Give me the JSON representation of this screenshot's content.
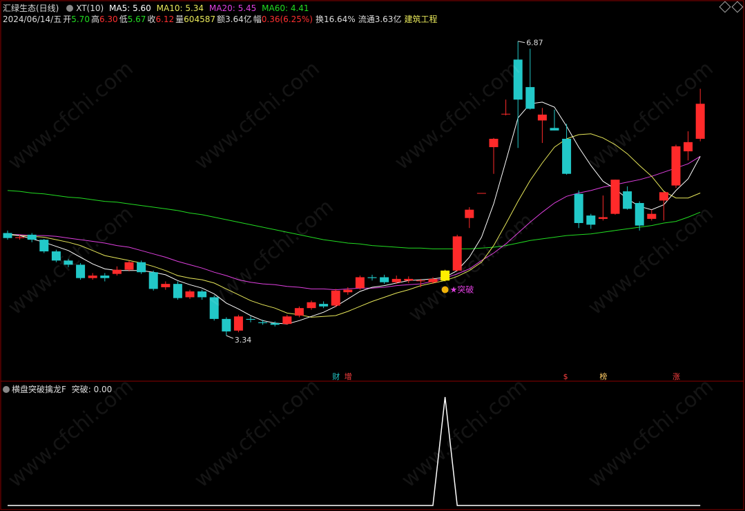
{
  "header": {
    "stock_name": "汇绿生态(日线)",
    "indicator": "XT(10)",
    "ma5": "MA5: 5.60",
    "ma10": "MA10: 5.34",
    "ma20": "MA20: 5.45",
    "ma60": "MA60: 4.41",
    "date": "2024/06/14/五",
    "open_label": "开",
    "open_value": "5.70",
    "high_label": "高",
    "high_value": "6.30",
    "low_label": "低",
    "low_value": "5.67",
    "close_label": "收",
    "close_value": "6.12",
    "volume_label": "量",
    "volume_value": "604587",
    "amount_label": "额",
    "amount_value": "3.64亿",
    "change_label": "幅",
    "change_value": "0.36(6.25%)",
    "turnover": "换16.64%",
    "float": "流通3.63亿",
    "sector": "建筑工程"
  },
  "sub_header": {
    "name": "横盘突破擒龙F",
    "value_label": "突破: 0.00"
  },
  "annotations": {
    "high_label": "6.87",
    "low_label": "3.34",
    "breakout_label": "突破"
  },
  "bottom_markers": [
    "财",
    "增",
    "$",
    "榜",
    "涨"
  ],
  "watermark_text": "www.cfchi.com",
  "colors": {
    "up": "#ff2a2a",
    "down": "#22c8c8",
    "ma5": "#ffffff",
    "ma10": "#e8e85a",
    "ma20": "#e040e0",
    "ma60": "#22dd22"
  },
  "chart_data": {
    "type": "candlestick",
    "y_range": [
      3.1,
      7.0
    ],
    "candles": [
      {
        "o": 4.57,
        "c": 4.51,
        "h": 4.6,
        "l": 4.49
      },
      {
        "o": 4.51,
        "c": 4.52,
        "h": 4.55,
        "l": 4.49
      },
      {
        "o": 4.55,
        "c": 4.49,
        "h": 4.57,
        "l": 4.46
      },
      {
        "o": 4.49,
        "c": 4.35,
        "h": 4.5,
        "l": 4.33
      },
      {
        "o": 4.35,
        "c": 4.24,
        "h": 4.37,
        "l": 4.22
      },
      {
        "o": 4.24,
        "c": 4.19,
        "h": 4.26,
        "l": 4.16
      },
      {
        "o": 4.19,
        "c": 4.03,
        "h": 4.21,
        "l": 4.01
      },
      {
        "o": 4.03,
        "c": 4.06,
        "h": 4.09,
        "l": 4.01
      },
      {
        "o": 4.06,
        "c": 4.03,
        "h": 4.09,
        "l": 3.99
      },
      {
        "o": 4.08,
        "c": 4.13,
        "h": 4.17,
        "l": 4.06
      },
      {
        "o": 4.13,
        "c": 4.22,
        "h": 4.24,
        "l": 4.11
      },
      {
        "o": 4.22,
        "c": 4.1,
        "h": 4.24,
        "l": 4.08
      },
      {
        "o": 4.1,
        "c": 3.9,
        "h": 4.12,
        "l": 3.88
      },
      {
        "o": 3.92,
        "c": 3.96,
        "h": 3.99,
        "l": 3.89
      },
      {
        "o": 3.96,
        "c": 3.79,
        "h": 3.99,
        "l": 3.77
      },
      {
        "o": 3.8,
        "c": 3.87,
        "h": 3.89,
        "l": 3.78
      },
      {
        "o": 3.87,
        "c": 3.8,
        "h": 3.89,
        "l": 3.77
      },
      {
        "o": 3.8,
        "c": 3.54,
        "h": 3.82,
        "l": 3.52
      },
      {
        "o": 3.54,
        "c": 3.39,
        "h": 3.56,
        "l": 3.34
      },
      {
        "o": 3.4,
        "c": 3.57,
        "h": 3.59,
        "l": 3.38
      },
      {
        "o": 3.54,
        "c": 3.53,
        "h": 3.57,
        "l": 3.5
      },
      {
        "o": 3.5,
        "c": 3.49,
        "h": 3.53,
        "l": 3.47
      },
      {
        "o": 3.49,
        "c": 3.47,
        "h": 3.51,
        "l": 3.45
      },
      {
        "o": 3.48,
        "c": 3.57,
        "h": 3.59,
        "l": 3.47
      },
      {
        "o": 3.58,
        "c": 3.67,
        "h": 3.69,
        "l": 3.56
      },
      {
        "o": 3.67,
        "c": 3.74,
        "h": 3.76,
        "l": 3.65
      },
      {
        "o": 3.72,
        "c": 3.69,
        "h": 3.75,
        "l": 3.67
      },
      {
        "o": 3.7,
        "c": 3.88,
        "h": 3.9,
        "l": 3.68
      },
      {
        "o": 3.86,
        "c": 3.89,
        "h": 3.92,
        "l": 3.83
      },
      {
        "o": 3.91,
        "c": 4.04,
        "h": 4.06,
        "l": 3.89
      },
      {
        "o": 4.04,
        "c": 4.03,
        "h": 4.07,
        "l": 4.0
      },
      {
        "o": 4.04,
        "c": 3.98,
        "h": 4.07,
        "l": 3.96
      },
      {
        "o": 3.98,
        "c": 4.02,
        "h": 4.06,
        "l": 3.96
      },
      {
        "o": 4.0,
        "c": 4.02,
        "h": 4.05,
        "l": 3.97
      },
      {
        "o": 4.0,
        "c": 4.0,
        "h": 4.02,
        "l": 3.92
      },
      {
        "o": 3.98,
        "c": 4.02,
        "h": 4.04,
        "l": 3.96
      },
      {
        "o": 4.0,
        "c": 4.12,
        "h": 4.13,
        "l": 3.99
      },
      {
        "o": 4.12,
        "c": 4.53,
        "h": 4.55,
        "l": 4.11
      },
      {
        "o": 4.75,
        "c": 4.85,
        "h": 4.88,
        "l": 4.63
      },
      {
        "o": 5.05,
        "c": 5.05,
        "h": 5.05,
        "l": 5.05
      },
      {
        "o": 5.6,
        "c": 5.7,
        "h": 5.71,
        "l": 5.28
      },
      {
        "o": 6.0,
        "c": 6.0,
        "h": 6.17,
        "l": 5.98
      },
      {
        "o": 6.65,
        "c": 6.17,
        "h": 6.87,
        "l": 5.59
      },
      {
        "o": 6.32,
        "c": 6.06,
        "h": 6.78,
        "l": 6.05
      },
      {
        "o": 5.92,
        "c": 5.99,
        "h": 6.07,
        "l": 5.65
      },
      {
        "o": 5.83,
        "c": 5.8,
        "h": 6.05,
        "l": 5.8
      },
      {
        "o": 5.7,
        "c": 5.28,
        "h": 5.88,
        "l": 5.27
      },
      {
        "o": 5.04,
        "c": 4.69,
        "h": 5.08,
        "l": 4.63
      },
      {
        "o": 4.78,
        "c": 4.67,
        "h": 4.8,
        "l": 4.62
      },
      {
        "o": 4.74,
        "c": 4.76,
        "h": 5.02,
        "l": 4.72
      },
      {
        "o": 4.8,
        "c": 5.21,
        "h": 5.21,
        "l": 4.79
      },
      {
        "o": 5.07,
        "c": 4.86,
        "h": 5.13,
        "l": 4.85
      },
      {
        "o": 4.93,
        "c": 4.66,
        "h": 4.95,
        "l": 4.6
      },
      {
        "o": 4.74,
        "c": 4.8,
        "h": 4.85,
        "l": 4.72
      },
      {
        "o": 4.96,
        "c": 5.06,
        "h": 5.06,
        "l": 4.72
      },
      {
        "o": 5.14,
        "c": 5.61,
        "h": 5.63,
        "l": 5.11
      },
      {
        "o": 5.55,
        "c": 5.66,
        "h": 5.79,
        "l": 5.44
      },
      {
        "o": 5.7,
        "c": 6.12,
        "h": 6.3,
        "l": 5.67
      }
    ],
    "ma5": [
      4.56,
      4.54,
      4.5,
      4.46,
      4.41,
      4.36,
      4.28,
      4.2,
      4.14,
      4.12,
      4.12,
      4.12,
      4.1,
      4.07,
      4.0,
      3.95,
      3.91,
      3.84,
      3.73,
      3.66,
      3.58,
      3.52,
      3.49,
      3.48,
      3.52,
      3.57,
      3.62,
      3.69,
      3.78,
      3.87,
      3.92,
      3.94,
      3.97,
      4.0,
      4.01,
      4.02,
      4.04,
      4.12,
      4.28,
      4.52,
      4.92,
      5.43,
      5.95,
      6.12,
      6.14,
      6.08,
      5.85,
      5.6,
      5.38,
      5.19,
      5.1,
      4.98,
      4.89,
      4.85,
      4.91,
      5.08,
      5.22,
      5.49
    ],
    "ma10": [
      4.55,
      4.54,
      4.53,
      4.52,
      4.49,
      4.46,
      4.42,
      4.36,
      4.3,
      4.27,
      4.24,
      4.21,
      4.17,
      4.12,
      4.06,
      4.03,
      4.01,
      3.97,
      3.9,
      3.83,
      3.76,
      3.71,
      3.67,
      3.61,
      3.59,
      3.56,
      3.57,
      3.58,
      3.63,
      3.69,
      3.75,
      3.8,
      3.85,
      3.89,
      3.94,
      3.97,
      4.0,
      4.05,
      4.12,
      4.22,
      4.42,
      4.68,
      4.95,
      5.2,
      5.41,
      5.6,
      5.7,
      5.75,
      5.76,
      5.71,
      5.63,
      5.52,
      5.38,
      5.25,
      5.07,
      4.99,
      4.99,
      5.05
    ],
    "ma20": [
      4.55,
      4.55,
      4.54,
      4.54,
      4.53,
      4.51,
      4.49,
      4.47,
      4.45,
      4.42,
      4.4,
      4.36,
      4.32,
      4.28,
      4.23,
      4.19,
      4.15,
      4.1,
      4.06,
      4.01,
      3.98,
      3.96,
      3.95,
      3.93,
      3.92,
      3.9,
      3.9,
      3.89,
      3.9,
      3.91,
      3.91,
      3.92,
      3.94,
      3.95,
      3.96,
      3.99,
      4.03,
      4.08,
      4.14,
      4.24,
      4.33,
      4.44,
      4.57,
      4.7,
      4.82,
      4.93,
      5.01,
      5.05,
      5.08,
      5.12,
      5.15,
      5.18,
      5.21,
      5.25,
      5.3,
      5.35,
      5.4,
      5.49
    ],
    "ma60": [
      5.08,
      5.07,
      5.05,
      5.04,
      5.02,
      5.0,
      4.99,
      4.97,
      4.95,
      4.94,
      4.92,
      4.9,
      4.88,
      4.86,
      4.84,
      4.81,
      4.79,
      4.76,
      4.73,
      4.7,
      4.67,
      4.64,
      4.61,
      4.58,
      4.55,
      4.52,
      4.49,
      4.47,
      4.45,
      4.44,
      4.42,
      4.41,
      4.4,
      4.39,
      4.39,
      4.38,
      4.38,
      4.38,
      4.38,
      4.39,
      4.4,
      4.42,
      4.45,
      4.48,
      4.5,
      4.52,
      4.54,
      4.55,
      4.56,
      4.58,
      4.6,
      4.62,
      4.64,
      4.66,
      4.69,
      4.71,
      4.76,
      4.82
    ],
    "xt_values": [
      0,
      0,
      0,
      0,
      0,
      0,
      0,
      0,
      0,
      0,
      0,
      0,
      0,
      0,
      0,
      0,
      0,
      0,
      0,
      0,
      0,
      0,
      0,
      0,
      0,
      0,
      0,
      0,
      0,
      0,
      0,
      0,
      0,
      0,
      0,
      0,
      1,
      0,
      0,
      0,
      0,
      0,
      0,
      0,
      0,
      0,
      0,
      0,
      0,
      0,
      0,
      0,
      0,
      0,
      0,
      0,
      0,
      0
    ],
    "breakout_index": 36
  }
}
